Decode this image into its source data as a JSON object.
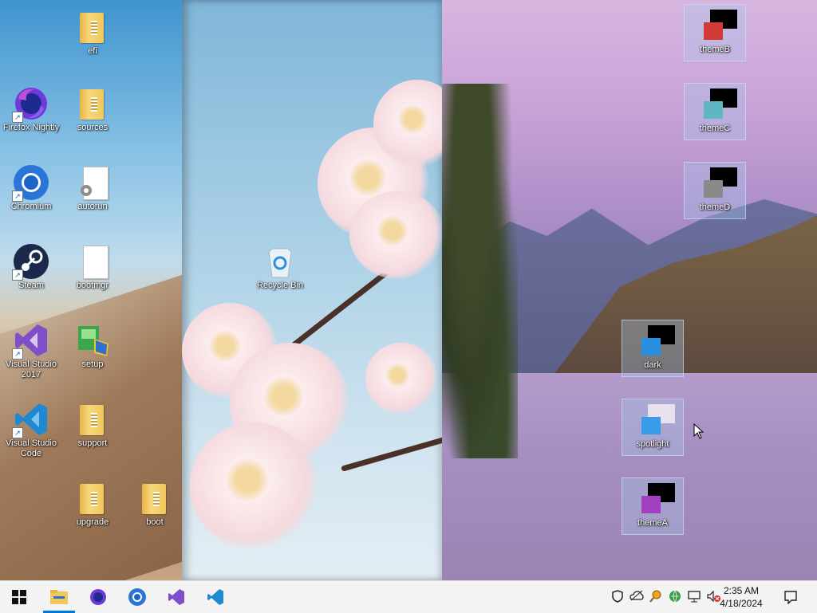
{
  "desktop": {
    "icons": [
      {
        "label": "efi",
        "icon": "folder-icon"
      },
      {
        "label": "Firefox Nightly",
        "icon": "firefox-nightly-icon"
      },
      {
        "label": "sources",
        "icon": "folder-icon"
      },
      {
        "label": "Chromium",
        "icon": "chromium-icon"
      },
      {
        "label": "autorun",
        "icon": "settings-file-icon"
      },
      {
        "label": "Steam",
        "icon": "steam-icon"
      },
      {
        "label": "bootmgr",
        "icon": "file-icon"
      },
      {
        "label": "Visual Studio 2017",
        "icon": "visual-studio-icon"
      },
      {
        "label": "setup",
        "icon": "setup-icon"
      },
      {
        "label": "Visual Studio Code",
        "icon": "vscode-icon"
      },
      {
        "label": "support",
        "icon": "folder-icon"
      },
      {
        "label": "upgrade",
        "icon": "folder-icon"
      },
      {
        "label": "boot",
        "icon": "folder-icon"
      },
      {
        "label": "Recycle Bin",
        "icon": "recycle-bin-icon"
      },
      {
        "label": "themeB",
        "icon": "theme-icon",
        "accent": "#d23a3a"
      },
      {
        "label": "themeC",
        "icon": "theme-icon",
        "accent": "#5fb7c4"
      },
      {
        "label": "themeD",
        "icon": "theme-icon",
        "accent": "#8a8a8a"
      },
      {
        "label": "dark",
        "icon": "theme-icon",
        "accent": "#2b8fe0"
      },
      {
        "label": "spotlight",
        "icon": "spotlight-theme-icon",
        "accent": "#3a9be8"
      },
      {
        "label": "themeA",
        "icon": "theme-icon",
        "accent": "#a13fc0"
      }
    ]
  },
  "taskbar": {
    "start": "windows-start-icon",
    "apps": [
      "file-explorer-icon",
      "firefox-nightly-icon",
      "chromium-icon",
      "visual-studio-icon",
      "vscode-icon"
    ],
    "tray": [
      "security-shield-icon",
      "onedrive-icon",
      "search-tool-icon",
      "network-globe-icon",
      "network-icon",
      "volume-muted-icon"
    ],
    "time": "2:35 AM",
    "date": "4/18/2024",
    "notifications": "notification-icon"
  },
  "colors": {
    "accent": "#0078d7",
    "taskbar_bg": "#f3f3f3"
  }
}
